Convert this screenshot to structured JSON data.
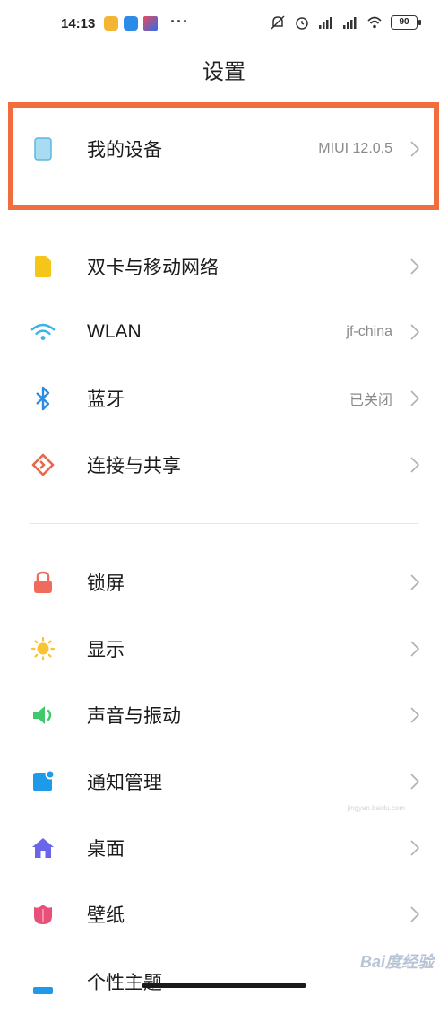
{
  "status_bar": {
    "time": "14:13",
    "more": "···",
    "battery": "90"
  },
  "page": {
    "title": "设置"
  },
  "rows": [
    {
      "label": "我的设备",
      "value": "MIUI 12.0.5",
      "icon": "tablet-icon"
    },
    {
      "label": "双卡与移动网络",
      "value": "",
      "icon": "sim-card-icon"
    },
    {
      "label": "WLAN",
      "value": "jf-china",
      "icon": "wifi-icon"
    },
    {
      "label": "蓝牙",
      "value": "已关闭",
      "icon": "bluetooth-icon"
    },
    {
      "label": "连接与共享",
      "value": "",
      "icon": "share-icon"
    },
    {
      "label": "锁屏",
      "value": "",
      "icon": "lock-icon"
    },
    {
      "label": "显示",
      "value": "",
      "icon": "sun-icon"
    },
    {
      "label": "声音与振动",
      "value": "",
      "icon": "speaker-icon"
    },
    {
      "label": "通知管理",
      "value": "",
      "icon": "notification-icon"
    },
    {
      "label": "桌面",
      "value": "",
      "icon": "home-icon"
    },
    {
      "label": "壁纸",
      "value": "",
      "icon": "flower-icon"
    },
    {
      "label": "个性主题",
      "value": "",
      "icon": "theme-icon"
    }
  ],
  "watermark": {
    "text": "Bai度经验",
    "sub": "jingyan.baidu.com"
  },
  "colors": {
    "highlight": "#f26d3d",
    "sim": "#f5c518",
    "wifi": "#3ab4e8",
    "bluetooth": "#2a8be0",
    "share": "#e8674a",
    "lock": "#ef6b5e",
    "sun": "#f7c531",
    "speaker": "#3ec96b",
    "notification": "#1e9be8",
    "home": "#6b66e8",
    "flower": "#e8507a"
  }
}
